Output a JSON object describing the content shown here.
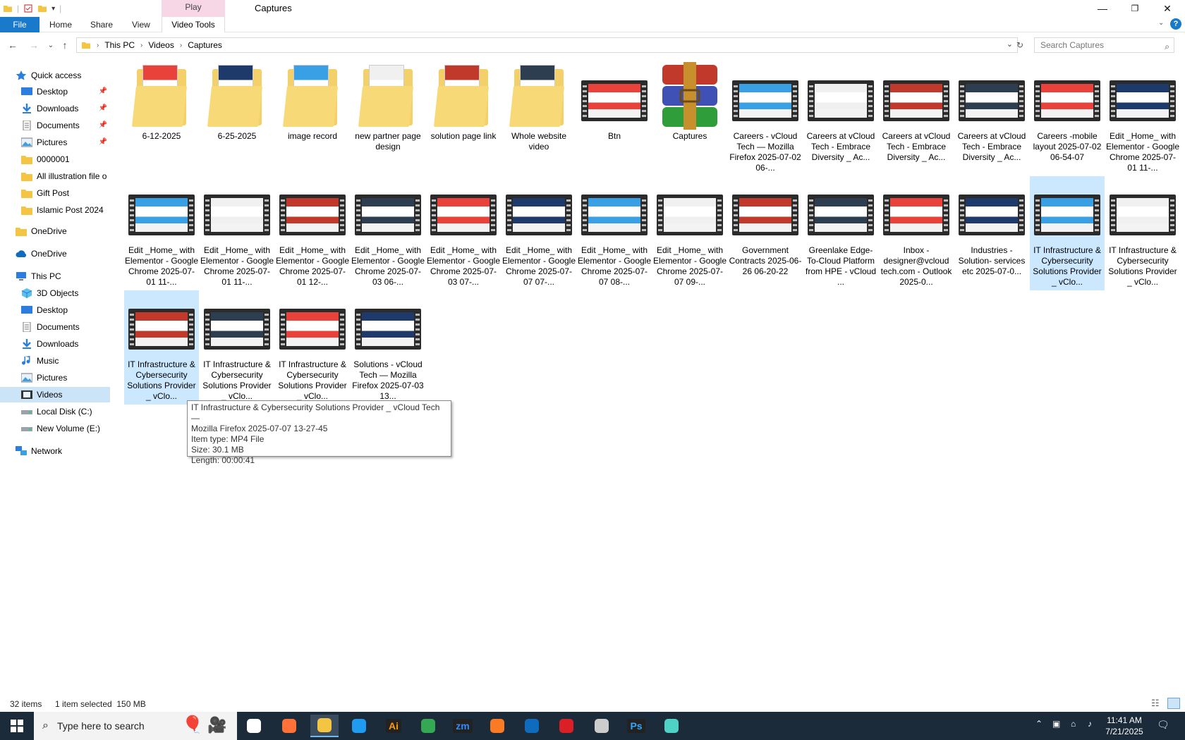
{
  "window": {
    "title": "Captures",
    "context_tab": "Play",
    "context_sub_tab": "Video Tools"
  },
  "ribbon": {
    "tabs": [
      "File",
      "Home",
      "Share",
      "View"
    ]
  },
  "address": {
    "crumbs": [
      "This PC",
      "Videos",
      "Captures"
    ]
  },
  "search": {
    "placeholder": "Search Captures"
  },
  "navpane": {
    "items": [
      {
        "label": "Quick access",
        "icon": "star-icon",
        "pin": false
      },
      {
        "label": "Desktop",
        "icon": "desktop-icon",
        "pin": true
      },
      {
        "label": "Downloads",
        "icon": "download-arrow-icon",
        "pin": true
      },
      {
        "label": "Documents",
        "icon": "documents-icon",
        "pin": true
      },
      {
        "label": "Pictures",
        "icon": "pictures-icon",
        "pin": true
      },
      {
        "label": "0000001",
        "icon": "folder-icon",
        "pin": false
      },
      {
        "label": "All illustration file o",
        "icon": "folder-icon",
        "pin": false
      },
      {
        "label": "Gift Post",
        "icon": "folder-icon",
        "pin": false
      },
      {
        "label": "Islamic Post 2024",
        "icon": "folder-icon",
        "pin": false
      },
      {
        "label": "OneDrive",
        "icon": "folder-icon",
        "pin": false
      },
      {
        "label": "OneDrive",
        "icon": "cloud-icon",
        "pin": false
      },
      {
        "label": "This PC",
        "icon": "computer-icon",
        "pin": false
      },
      {
        "label": "3D Objects",
        "icon": "cube-icon",
        "pin": false
      },
      {
        "label": "Desktop",
        "icon": "desktop-icon",
        "pin": false
      },
      {
        "label": "Documents",
        "icon": "documents-icon",
        "pin": false
      },
      {
        "label": "Downloads",
        "icon": "download-arrow-icon",
        "pin": false
      },
      {
        "label": "Music",
        "icon": "music-note-icon",
        "pin": false
      },
      {
        "label": "Pictures",
        "icon": "pictures-icon",
        "pin": false
      },
      {
        "label": "Videos",
        "icon": "video-icon",
        "pin": false,
        "selected": true
      },
      {
        "label": "Local Disk (C:)",
        "icon": "drive-icon",
        "pin": false
      },
      {
        "label": "New Volume (E:)",
        "icon": "drive-icon",
        "pin": false
      },
      {
        "label": "Network",
        "icon": "network-icon",
        "pin": false
      }
    ]
  },
  "files": [
    {
      "label": "6-12-2025",
      "kind": "folder"
    },
    {
      "label": "6-25-2025",
      "kind": "folder"
    },
    {
      "label": "image record",
      "kind": "folder"
    },
    {
      "label": "new partner page design",
      "kind": "folder"
    },
    {
      "label": "solution page link",
      "kind": "folder"
    },
    {
      "label": "Whole website video",
      "kind": "folder"
    },
    {
      "label": "Btn",
      "kind": "video"
    },
    {
      "label": "Captures",
      "kind": "archive"
    },
    {
      "label": "Careers - vCloud Tech — Mozilla Firefox 2025-07-02 06-...",
      "kind": "video"
    },
    {
      "label": "Careers at vCloud Tech - Embrace Diversity _ Ac...",
      "kind": "video"
    },
    {
      "label": "Careers at vCloud Tech - Embrace Diversity _ Ac...",
      "kind": "video"
    },
    {
      "label": "Careers at vCloud Tech - Embrace Diversity _ Ac...",
      "kind": "video"
    },
    {
      "label": "Careers -mobile layout 2025-07-02 06-54-07",
      "kind": "video"
    },
    {
      "label": "Edit _Home_ with Elementor - Google Chrome 2025-07-01 11-...",
      "kind": "video"
    },
    {
      "label": "Edit _Home_ with Elementor - Google Chrome 2025-07-01 11-...",
      "kind": "video"
    },
    {
      "label": "Edit _Home_ with Elementor - Google Chrome 2025-07-01 11-...",
      "kind": "video"
    },
    {
      "label": "Edit _Home_ with Elementor - Google Chrome 2025-07-01 12-...",
      "kind": "video"
    },
    {
      "label": "Edit _Home_ with Elementor - Google Chrome 2025-07-03 06-...",
      "kind": "video"
    },
    {
      "label": "Edit _Home_ with Elementor - Google Chrome 2025-07-03 07-...",
      "kind": "video"
    },
    {
      "label": "Edit _Home_ with Elementor - Google Chrome 2025-07-07 07-...",
      "kind": "video"
    },
    {
      "label": "Edit _Home_ with Elementor - Google Chrome 2025-07-07 08-...",
      "kind": "video"
    },
    {
      "label": "Edit _Home_ with Elementor - Google Chrome 2025-07-07 09-...",
      "kind": "video"
    },
    {
      "label": "Government Contracts 2025-06-26 06-20-22",
      "kind": "video"
    },
    {
      "label": "Greenlake Edge-To-Cloud Platform from HPE - vCloud ...",
      "kind": "video"
    },
    {
      "label": "Inbox - designer@vcloud tech.com - Outlook 2025-0...",
      "kind": "video"
    },
    {
      "label": "Industries -Solution- services etc 2025-07-0...",
      "kind": "video"
    },
    {
      "label": "IT Infrastructure & Cybersecurity Solutions Provider _ vClo...",
      "kind": "video",
      "selected": true
    },
    {
      "label": "IT Infrastructure & Cybersecurity Solutions Provider _ vClo...",
      "kind": "video"
    },
    {
      "label": "IT Infrastructure & Cybersecurity Solutions Provider _ vClo...",
      "kind": "video",
      "hover": true
    },
    {
      "label": "IT Infrastructure & Cybersecurity Solutions Provider _ vClo...",
      "kind": "video"
    },
    {
      "label": "IT Infrastructure & Cybersecurity Solutions Provider _ vClo...",
      "kind": "video"
    },
    {
      "label": "Solutions - vCloud Tech — Mozilla Firefox 2025-07-03 13...",
      "kind": "video"
    }
  ],
  "tooltip": {
    "line1": "IT Infrastructure & Cybersecurity Solutions Provider _ vCloud Tech —",
    "line2": "Mozilla Firefox 2025-07-07 13-27-45",
    "line3": "Item type: MP4 File",
    "line4": "Size: 30.1 MB",
    "line5": "Length: 00:00:41"
  },
  "status": {
    "count": "32 items",
    "selection": "1 item selected  150 MB"
  },
  "taskbar": {
    "search_placeholder": "Type here to search",
    "time": "11:41 AM",
    "date": "7/21/2025",
    "apps": [
      {
        "name": "task-view-icon",
        "label": "",
        "color": "#ffffff"
      },
      {
        "name": "firefox-icon",
        "label": "",
        "color": "#ff7139"
      },
      {
        "name": "file-explorer-icon",
        "label": "",
        "color": "#f4c542"
      },
      {
        "name": "vscode-icon",
        "label": "",
        "color": "#1f9cf0"
      },
      {
        "name": "illustrator-icon",
        "label": "Ai",
        "color": "#ff9a00"
      },
      {
        "name": "chrome-icon",
        "label": "",
        "color": "#34a853"
      },
      {
        "name": "zoom-icon",
        "label": "zm",
        "color": "#2d8cff"
      },
      {
        "name": "xampp-icon",
        "label": "",
        "color": "#fb7a24"
      },
      {
        "name": "outlook-icon",
        "label": "",
        "color": "#0f6cbd"
      },
      {
        "name": "creative-cloud-icon",
        "label": "",
        "color": "#da1f26"
      },
      {
        "name": "pen-tool-icon",
        "label": "",
        "color": "#cccccc"
      },
      {
        "name": "photoshop-icon",
        "label": "Ps",
        "color": "#31a8ff"
      },
      {
        "name": "app-diamond-icon",
        "label": "",
        "color": "#4fd1c5"
      }
    ]
  },
  "colors": {
    "accent": "#1979ca",
    "selection": "#cce8ff",
    "taskbar": "#1c2b3a"
  }
}
